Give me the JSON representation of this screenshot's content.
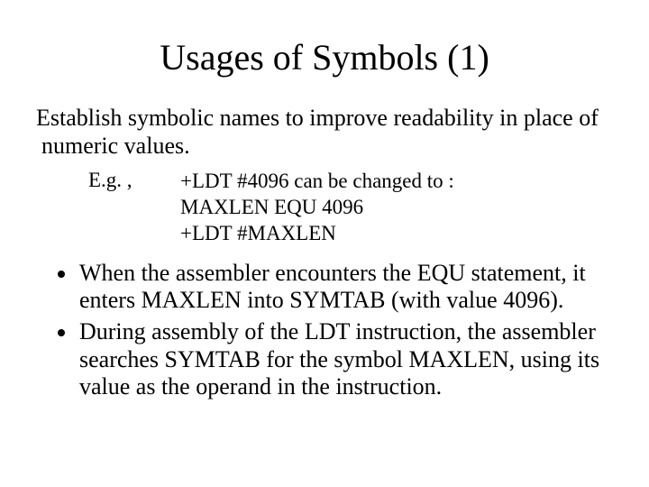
{
  "title": "Usages of Symbols (1)",
  "intro": "Establish symbolic names to improve readability in place of numeric values.",
  "example": {
    "label": "E.g. ,",
    "lines": [
      "+LDT #4096 can be changed to :",
      "MAXLEN EQU 4096",
      "+LDT #MAXLEN"
    ]
  },
  "bullets": [
    "When the assembler encounters the EQU statement, it enters MAXLEN into SYMTAB (with value 4096).",
    "During assembly of the LDT instruction, the assembler searches SYMTAB for the symbol MAXLEN, using its value as the operand in the instruction."
  ]
}
